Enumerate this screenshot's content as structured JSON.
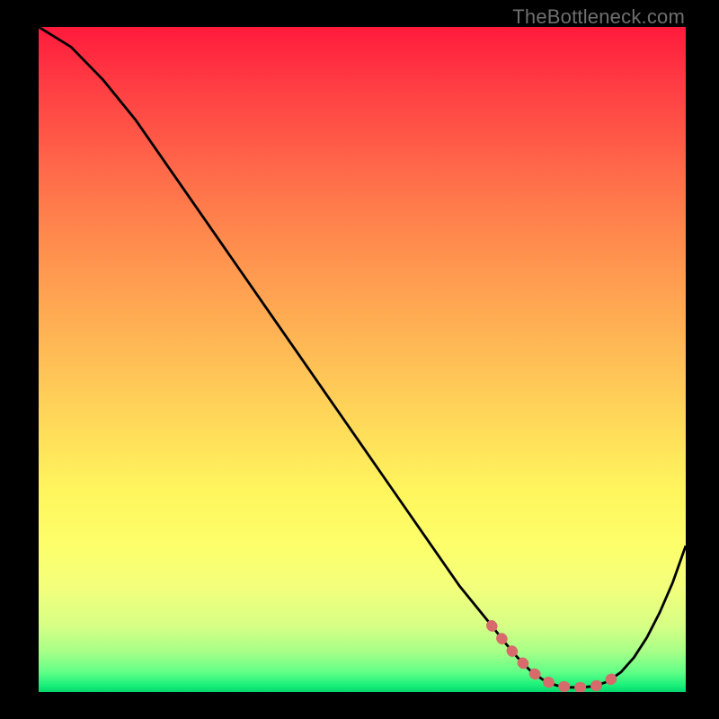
{
  "watermark": "TheBottleneck.com",
  "colors": {
    "background": "#000000",
    "curve": "#000000",
    "dots": "#d76a6a",
    "gradient_top": "#ff1a3c",
    "gradient_bottom": "#06d66c"
  },
  "chart_data": {
    "type": "line",
    "title": "",
    "xlabel": "",
    "ylabel": "",
    "xlim": [
      0,
      100
    ],
    "ylim": [
      0,
      100
    ],
    "x": [
      0,
      5,
      10,
      15,
      20,
      25,
      30,
      35,
      40,
      45,
      50,
      55,
      60,
      65,
      70,
      72,
      74,
      76,
      78,
      80,
      82,
      84,
      86,
      88,
      90,
      92,
      94,
      96,
      98,
      100
    ],
    "y": [
      100,
      97,
      92,
      86,
      79,
      72,
      65,
      58,
      51,
      44,
      37,
      30,
      23,
      16,
      10,
      7.5,
      5.2,
      3.2,
      1.8,
      1.0,
      0.7,
      0.7,
      0.9,
      1.6,
      3.0,
      5.2,
      8.2,
      12.0,
      16.5,
      22
    ],
    "dotted_segment": {
      "x": [
        70,
        72,
        74,
        76,
        78,
        80,
        82,
        84,
        86,
        88,
        90
      ],
      "y": [
        10,
        7.5,
        5.2,
        3.2,
        1.8,
        1.0,
        0.7,
        0.7,
        0.9,
        1.6,
        3.0
      ]
    }
  }
}
